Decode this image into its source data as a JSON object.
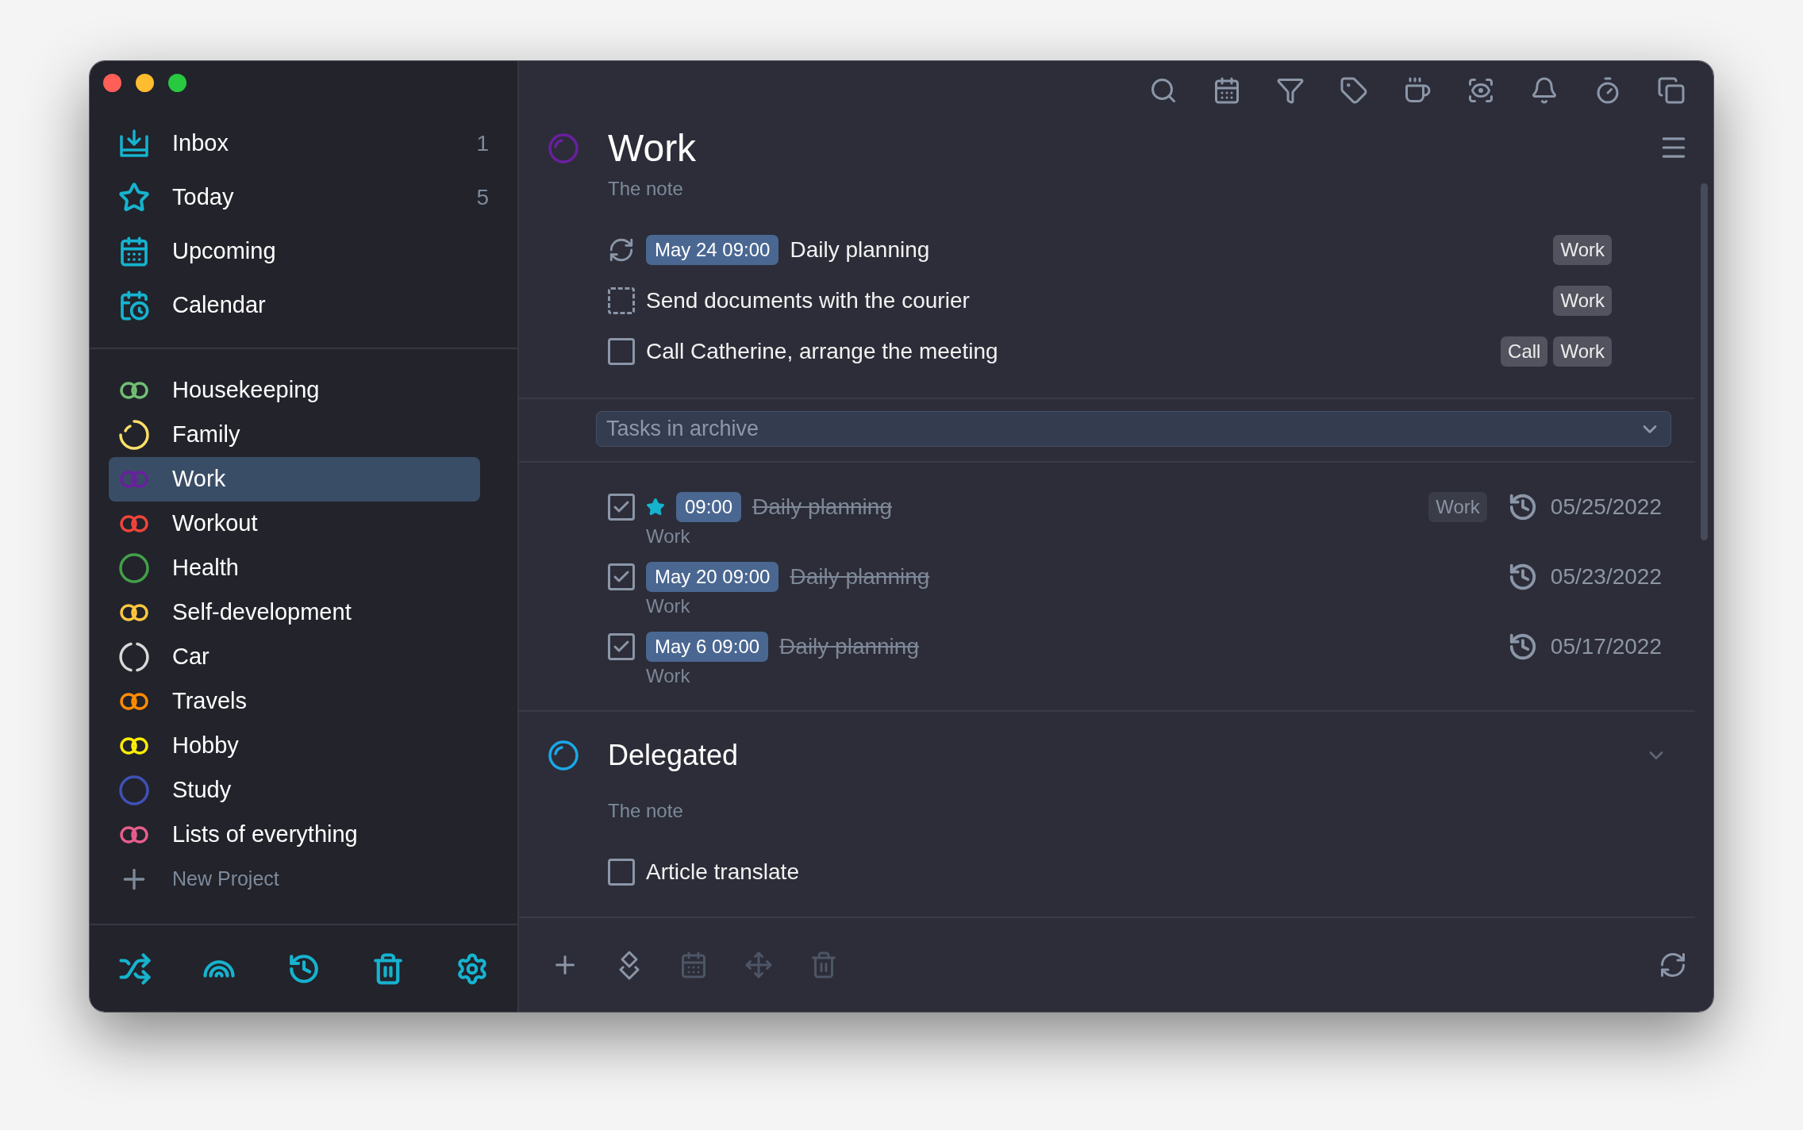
{
  "sidebar": {
    "nav": [
      {
        "kind": "inbox",
        "label": "Inbox",
        "count": "1"
      },
      {
        "kind": "today",
        "label": "Today",
        "count": "5"
      },
      {
        "kind": "upcoming",
        "label": "Upcoming"
      },
      {
        "kind": "calendar",
        "label": "Calendar"
      }
    ],
    "projects": [
      {
        "label": "Housekeeping",
        "kind": "linked",
        "color": "#6fbf73",
        "selected": false
      },
      {
        "label": "Family",
        "kind": "partial",
        "color": "#ffe066",
        "selected": false
      },
      {
        "label": "Work",
        "kind": "linked",
        "color": "#6a1fa0",
        "selected": true
      },
      {
        "label": "Workout",
        "kind": "linked",
        "color": "#f0443a",
        "selected": false
      },
      {
        "label": "Health",
        "kind": "circle",
        "color": "#43a047",
        "selected": false
      },
      {
        "label": "Self-development",
        "kind": "linked",
        "color": "#ffc83d",
        "selected": false
      },
      {
        "label": "Car",
        "kind": "split",
        "color": "#d8d8d8",
        "selected": false
      },
      {
        "label": "Travels",
        "kind": "linked",
        "color": "#ff8c00",
        "selected": false
      },
      {
        "label": "Hobby",
        "kind": "linked",
        "color": "#ffee00",
        "selected": false
      },
      {
        "label": "Study",
        "kind": "circle",
        "color": "#3f51b5",
        "selected": false
      },
      {
        "label": "Lists of everything",
        "kind": "linked",
        "color": "#e85d8c",
        "selected": false
      }
    ],
    "new_project": "New Project"
  },
  "project": {
    "title": "Work",
    "color": "#6a1fa0",
    "note": "The note",
    "tasks": [
      {
        "kind": "repeat",
        "checked": false,
        "date": "May 24 09:00",
        "title": "Daily planning",
        "tags": [
          "Work"
        ]
      },
      {
        "kind": "someday",
        "checked": false,
        "title": "Send documents with the courier",
        "tags": [
          "Work"
        ]
      },
      {
        "kind": "task",
        "checked": false,
        "title": "Call Catherine, arrange the meeting",
        "tags": [
          "Call",
          "Work"
        ]
      }
    ]
  },
  "archive": {
    "label": "Tasks in archive",
    "tasks": [
      {
        "checked": true,
        "starred": true,
        "date": "09:00",
        "title": "Daily planning",
        "project": "Work",
        "tags": [
          "Work"
        ],
        "completed": "05/25/2022"
      },
      {
        "checked": true,
        "starred": false,
        "date": "May 20 09:00",
        "title": "Daily planning",
        "project": "Work",
        "completed": "05/23/2022"
      },
      {
        "checked": true,
        "starred": false,
        "date": "May 6 09:00",
        "title": "Daily planning",
        "project": "Work",
        "completed": "05/17/2022"
      }
    ]
  },
  "delegated": {
    "title": "Delegated",
    "color": "#1aa7e8",
    "note": "The note",
    "tasks": [
      {
        "kind": "task",
        "checked": false,
        "title": "Article translate"
      }
    ]
  }
}
